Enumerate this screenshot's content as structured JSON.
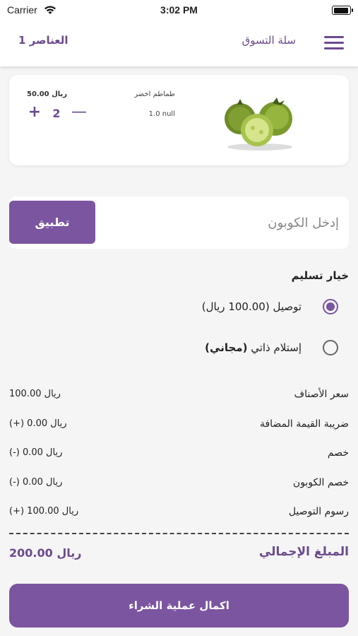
{
  "status_bar": {
    "carrier": "Carrier",
    "time": "3:02 PM"
  },
  "nav": {
    "items_count": "1 العناصر",
    "title": "سلة التسوق",
    "menu_icon": "hamburger-menu-icon"
  },
  "cart": {
    "item": {
      "name": "طماطم اخضر",
      "weight": "1.0 null",
      "price": "50.00 ريال",
      "quantity": "2",
      "image": "green-tomatoes-image"
    }
  },
  "coupon": {
    "placeholder": "إدخل الكوبون",
    "apply_label": "تطبيق"
  },
  "delivery": {
    "title": "خيار تسليم",
    "options": [
      {
        "label": "توصيل",
        "price": "(100.00 ريال)",
        "selected": true
      },
      {
        "label": "إستلام ذاتي",
        "price": "(مجاني)",
        "selected": false
      }
    ]
  },
  "summary": {
    "rows": [
      {
        "label": "سعر الأصناف",
        "value": "100.00 ريال"
      },
      {
        "label": "ضريبة القيمة المضافة",
        "value": "(+) 0.00 ريال"
      },
      {
        "label": "خصم",
        "value": "(-) 0.00 ريال"
      },
      {
        "label": "خصم الكوبون",
        "value": "(-) 0.00 ريال"
      },
      {
        "label": "رسوم التوصيل",
        "value": "(+) 100.00 ريال"
      }
    ],
    "total_label": "المبلغ الإجمالي",
    "total_value": "200.00 ريال"
  },
  "checkout": {
    "label": "اكمال عملية الشراء"
  },
  "colors": {
    "accent": "#7b55a0",
    "accent_text": "#6b4a8e"
  }
}
